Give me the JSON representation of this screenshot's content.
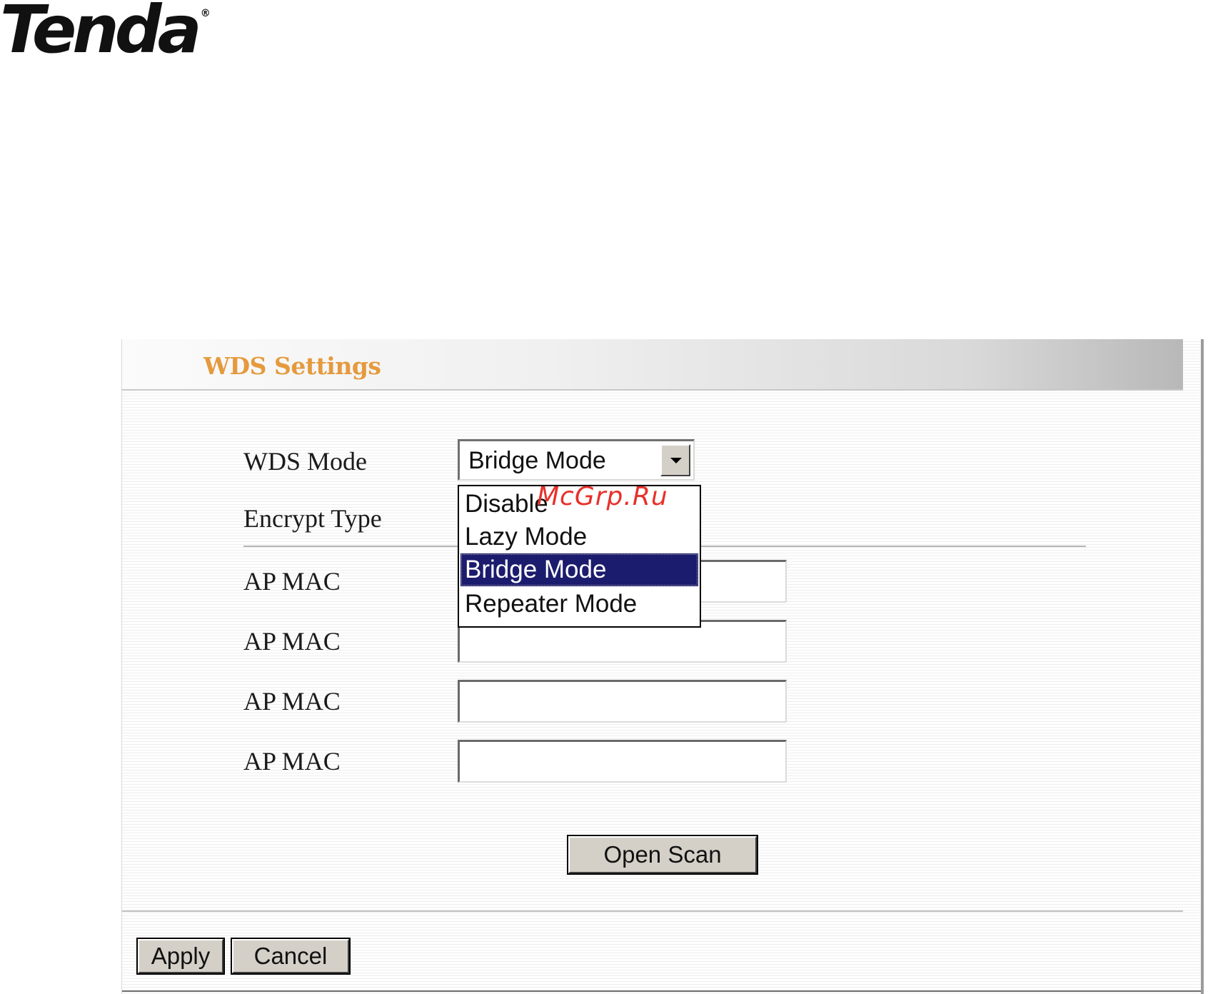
{
  "brand": {
    "logo_text": "Tenda",
    "registered_mark": "®"
  },
  "panel": {
    "title": "WDS Settings"
  },
  "form": {
    "wds_mode_label": "WDS Mode",
    "wds_mode_value": "Bridge Mode",
    "encrypt_type_label": "Encrypt Type",
    "dropdown_options": [
      {
        "label": "Disable",
        "selected": false
      },
      {
        "label": "Lazy Mode",
        "selected": false
      },
      {
        "label": "Bridge Mode",
        "selected": true
      },
      {
        "label": "Repeater Mode",
        "selected": false
      }
    ],
    "ap_mac_fields": [
      {
        "label": "AP MAC",
        "value": ""
      },
      {
        "label": "AP MAC",
        "value": ""
      },
      {
        "label": "AP MAC",
        "value": ""
      },
      {
        "label": "AP MAC",
        "value": ""
      }
    ],
    "open_scan_label": "Open Scan"
  },
  "footer": {
    "apply_label": "Apply",
    "cancel_label": "Cancel"
  },
  "watermark": {
    "text": "McGrp.Ru"
  },
  "colors": {
    "title": "#e59a3d",
    "selection": "#1c1c6e",
    "watermark": "#e8302a",
    "button_face": "#d4d0c8"
  }
}
